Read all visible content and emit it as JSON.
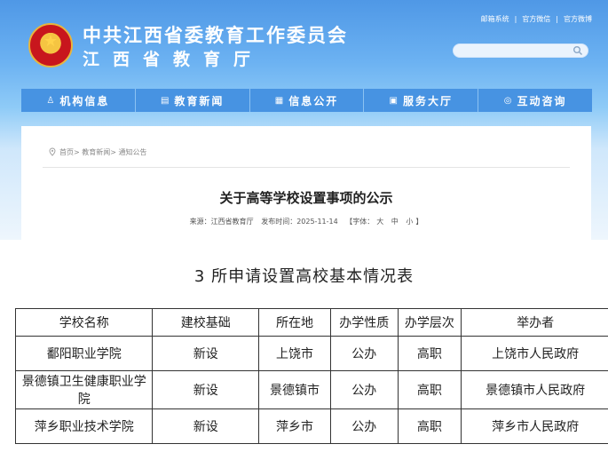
{
  "header": {
    "title_line1": "中共江西省委教育工作委员会",
    "title_line2": "江西省教育厅",
    "links": [
      "邮箱系统",
      "官方微信",
      "官方微博"
    ],
    "search_placeholder": ""
  },
  "nav": [
    {
      "label": "机构信息",
      "icon": "org-icon"
    },
    {
      "label": "教育新闻",
      "icon": "news-icon"
    },
    {
      "label": "信息公开",
      "icon": "doc-icon"
    },
    {
      "label": "服务大厅",
      "icon": "service-icon"
    },
    {
      "label": "互动咨询",
      "icon": "chat-icon"
    }
  ],
  "breadcrumb": [
    "首页",
    "教育新闻",
    "通知公告"
  ],
  "article": {
    "title": "关于高等学校设置事项的公示",
    "source": "来源：江西省教育厅",
    "published": "发布时间：2025-11-14",
    "font_prefix": "【字体：",
    "font_sizes": [
      "大",
      "中",
      "小"
    ],
    "font_suffix": "】"
  },
  "table": {
    "caption": "3 所申请设置高校基本情况表",
    "headers": [
      "学校名称",
      "建校基础",
      "所在地",
      "办学性质",
      "办学层次",
      "举办者"
    ],
    "rows": [
      [
        "鄱阳职业学院",
        "新设",
        "上饶市",
        "公办",
        "高职",
        "上饶市人民政府"
      ],
      [
        "景德镇卫生健康职业学院",
        "新设",
        "景德镇市",
        "公办",
        "高职",
        "景德镇市人民政府"
      ],
      [
        "萍乡职业技术学院",
        "新设",
        "萍乡市",
        "公办",
        "高职",
        "萍乡市人民政府"
      ]
    ]
  },
  "colors": {
    "nav_bg": "#4793e2",
    "banner_top": "#4f98e6"
  }
}
